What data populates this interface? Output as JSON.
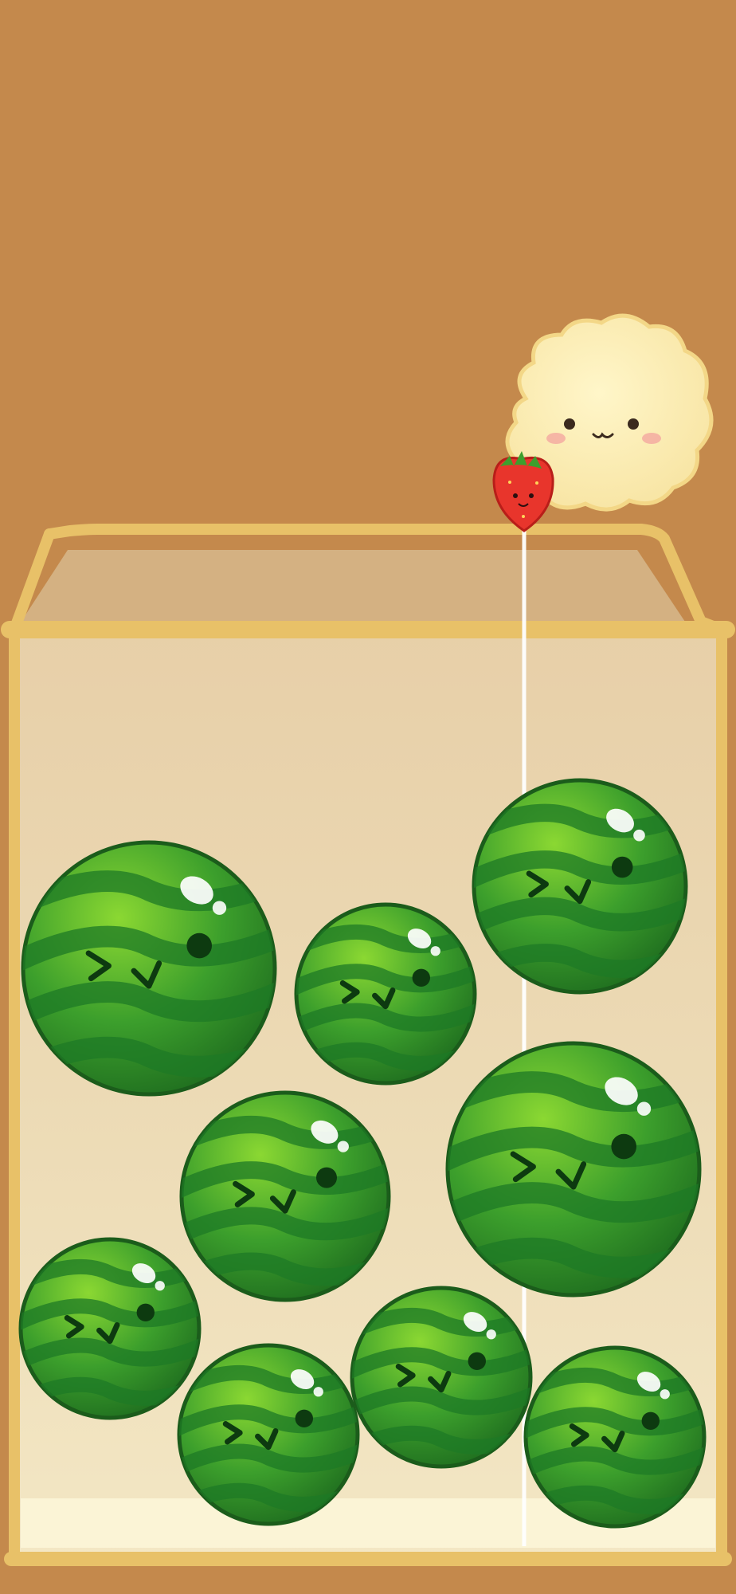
{
  "scene": {
    "background_color": "#c4894c",
    "container_color": "#e8c168",
    "container_inner_color": "#efe2c3",
    "drop_line_color": "#ffffff"
  },
  "dropper": {
    "character": "cloud-character",
    "held_fruit": "strawberry"
  },
  "fruits": [
    {
      "type": "watermelon",
      "face": "wink-happy"
    },
    {
      "type": "watermelon",
      "face": "wink-happy"
    },
    {
      "type": "watermelon",
      "face": "wink-happy"
    },
    {
      "type": "watermelon",
      "face": "wink-happy"
    },
    {
      "type": "watermelon",
      "face": "wink-happy"
    },
    {
      "type": "watermelon",
      "face": "wink-happy"
    },
    {
      "type": "watermelon",
      "face": "wink-happy"
    },
    {
      "type": "watermelon",
      "face": "wink-happy"
    },
    {
      "type": "watermelon",
      "face": "wink-happy"
    }
  ]
}
